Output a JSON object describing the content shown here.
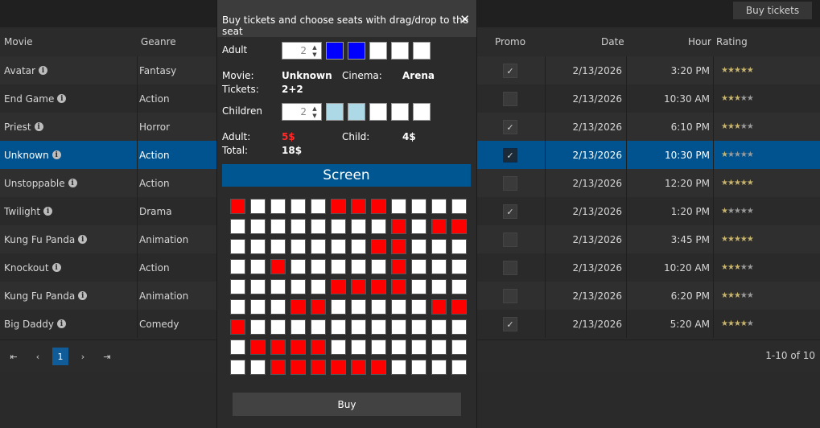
{
  "toolbar": {
    "buy_tickets": "Buy tickets"
  },
  "columns": {
    "movie": "Movie",
    "genre": "Geanre",
    "promo": "Promo",
    "date": "Date",
    "hour": "Hour",
    "rating": "Rating"
  },
  "rows": [
    {
      "movie": "Avatar",
      "genre": "Fantasy",
      "promo": true,
      "date": "2/13/2026",
      "hour": "3:20 PM",
      "rating": 5
    },
    {
      "movie": "End Game",
      "genre": "Action",
      "promo": false,
      "date": "2/13/2026",
      "hour": "10:30 AM",
      "rating": 3
    },
    {
      "movie": "Priest",
      "genre": "Horror",
      "promo": true,
      "date": "2/13/2026",
      "hour": "6:10 PM",
      "rating": 3
    },
    {
      "movie": "Unknown",
      "genre": "Action",
      "promo": true,
      "date": "2/13/2026",
      "hour": "10:30 PM",
      "rating": 1
    },
    {
      "movie": "Unstoppable",
      "genre": "Action",
      "promo": false,
      "date": "2/13/2026",
      "hour": "12:20 PM",
      "rating": 5
    },
    {
      "movie": "Twilight",
      "genre": "Drama",
      "promo": true,
      "date": "2/13/2026",
      "hour": "1:20 PM",
      "rating": 1
    },
    {
      "movie": "Kung Fu Panda",
      "genre": "Animation",
      "promo": false,
      "date": "2/13/2026",
      "hour": "3:45 PM",
      "rating": 5
    },
    {
      "movie": "Knockout",
      "genre": "Action",
      "promo": false,
      "date": "2/13/2026",
      "hour": "10:20 AM",
      "rating": 3
    },
    {
      "movie": "Kung Fu Panda",
      "genre": "Animation",
      "promo": false,
      "date": "2/13/2026",
      "hour": "6:20 PM",
      "rating": 3
    },
    {
      "movie": "Big Daddy",
      "genre": "Comedy",
      "promo": true,
      "date": "2/13/2026",
      "hour": "5:20 AM",
      "rating": 4
    }
  ],
  "selected_row": 3,
  "pager": {
    "first": "⇤",
    "prev": "‹",
    "current": "1",
    "next": "›",
    "last": "⇥",
    "info": "1-10 of 10"
  },
  "dialog": {
    "title": "Buy tickets and choose seats with drag/drop to the seat",
    "close": "✕",
    "adult_label": "Adult",
    "adult_count": "2",
    "adult_tickets": [
      "filled",
      "filled",
      "empty",
      "empty",
      "empty"
    ],
    "movie_label": "Movie:",
    "movie_value": "Unknown",
    "cinema_label": "Cinema:",
    "cinema_value": "Arena",
    "tickets_label": "Tickets:",
    "tickets_value": "2+2",
    "children_label": "Children",
    "children_count": "2",
    "children_tickets": [
      "filled",
      "filled",
      "empty",
      "empty",
      "empty"
    ],
    "adult_price_label": "Adult:",
    "adult_price": "5$",
    "child_price_label": "Child:",
    "child_price": "4$",
    "total_label": "Total:",
    "total_value": "18$",
    "screen_label": "Screen",
    "buy_label": "Buy"
  },
  "seats": [
    [
      1,
      0,
      0,
      0,
      0,
      1,
      1,
      1,
      0,
      0,
      0,
      0
    ],
    [
      0,
      0,
      0,
      0,
      0,
      0,
      0,
      0,
      1,
      0,
      1,
      1
    ],
    [
      0,
      0,
      0,
      0,
      0,
      0,
      0,
      1,
      1,
      0,
      0,
      0
    ],
    [
      0,
      0,
      1,
      0,
      0,
      0,
      0,
      0,
      1,
      0,
      0,
      0
    ],
    [
      0,
      0,
      0,
      0,
      0,
      1,
      1,
      1,
      1,
      0,
      0,
      0
    ],
    [
      0,
      0,
      0,
      1,
      1,
      0,
      0,
      0,
      0,
      0,
      1,
      1
    ],
    [
      1,
      0,
      0,
      0,
      0,
      0,
      0,
      0,
      0,
      0,
      0,
      0
    ],
    [
      0,
      1,
      1,
      1,
      1,
      0,
      0,
      0,
      0,
      0,
      0,
      0
    ],
    [
      0,
      0,
      1,
      1,
      1,
      1,
      1,
      1,
      0,
      0,
      0,
      0
    ]
  ],
  "colors": {
    "adult_ticket": "#0000ff",
    "child_ticket": "#add8e6",
    "taken_seat": "#ff0000",
    "free_seat": "#ffffff",
    "selection": "#00538f",
    "star": "#c8b46a",
    "star_off": "#9a9a9a"
  }
}
